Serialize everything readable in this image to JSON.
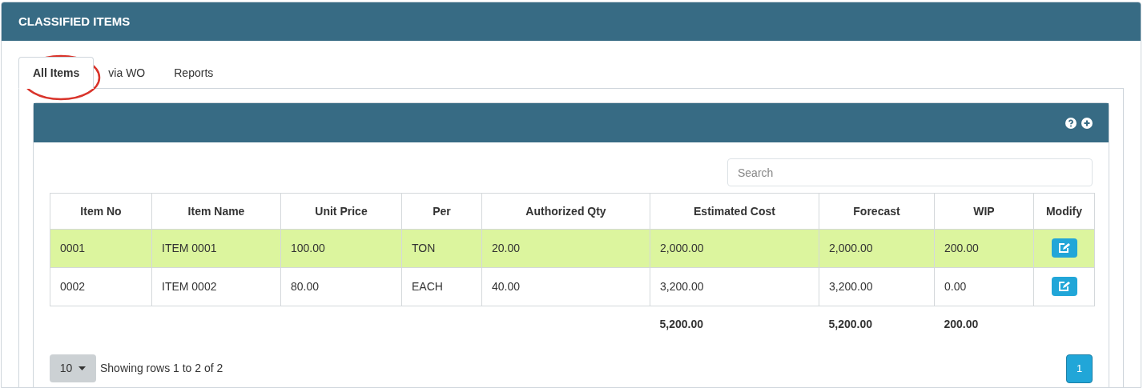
{
  "panel": {
    "title": "CLASSIFIED ITEMS"
  },
  "tabs": [
    {
      "label": "All Items",
      "selected": true
    },
    {
      "label": "via WO",
      "selected": false
    },
    {
      "label": "Reports",
      "selected": false
    }
  ],
  "search": {
    "placeholder": "Search"
  },
  "table": {
    "columns": [
      "Item No",
      "Item Name",
      "Unit Price",
      "Per",
      "Authorized Qty",
      "Estimated Cost",
      "Forecast",
      "WIP",
      "Modify"
    ],
    "rows": [
      {
        "selected": true,
        "cells": [
          "0001",
          "ITEM 0001",
          "100.00",
          "TON",
          "20.00",
          "2,000.00",
          "2,000.00",
          "200.00"
        ]
      },
      {
        "selected": false,
        "cells": [
          "0002",
          "ITEM 0002",
          "80.00",
          "EACH",
          "40.00",
          "3,200.00",
          "3,200.00",
          "0.00"
        ]
      }
    ],
    "totals": [
      "5,200.00",
      "5,200.00",
      "200.00"
    ]
  },
  "pagination": {
    "page_size": "10",
    "summary": "Showing rows 1 to 2 of 2",
    "pages": [
      {
        "label": "1",
        "selected": true
      }
    ]
  }
}
